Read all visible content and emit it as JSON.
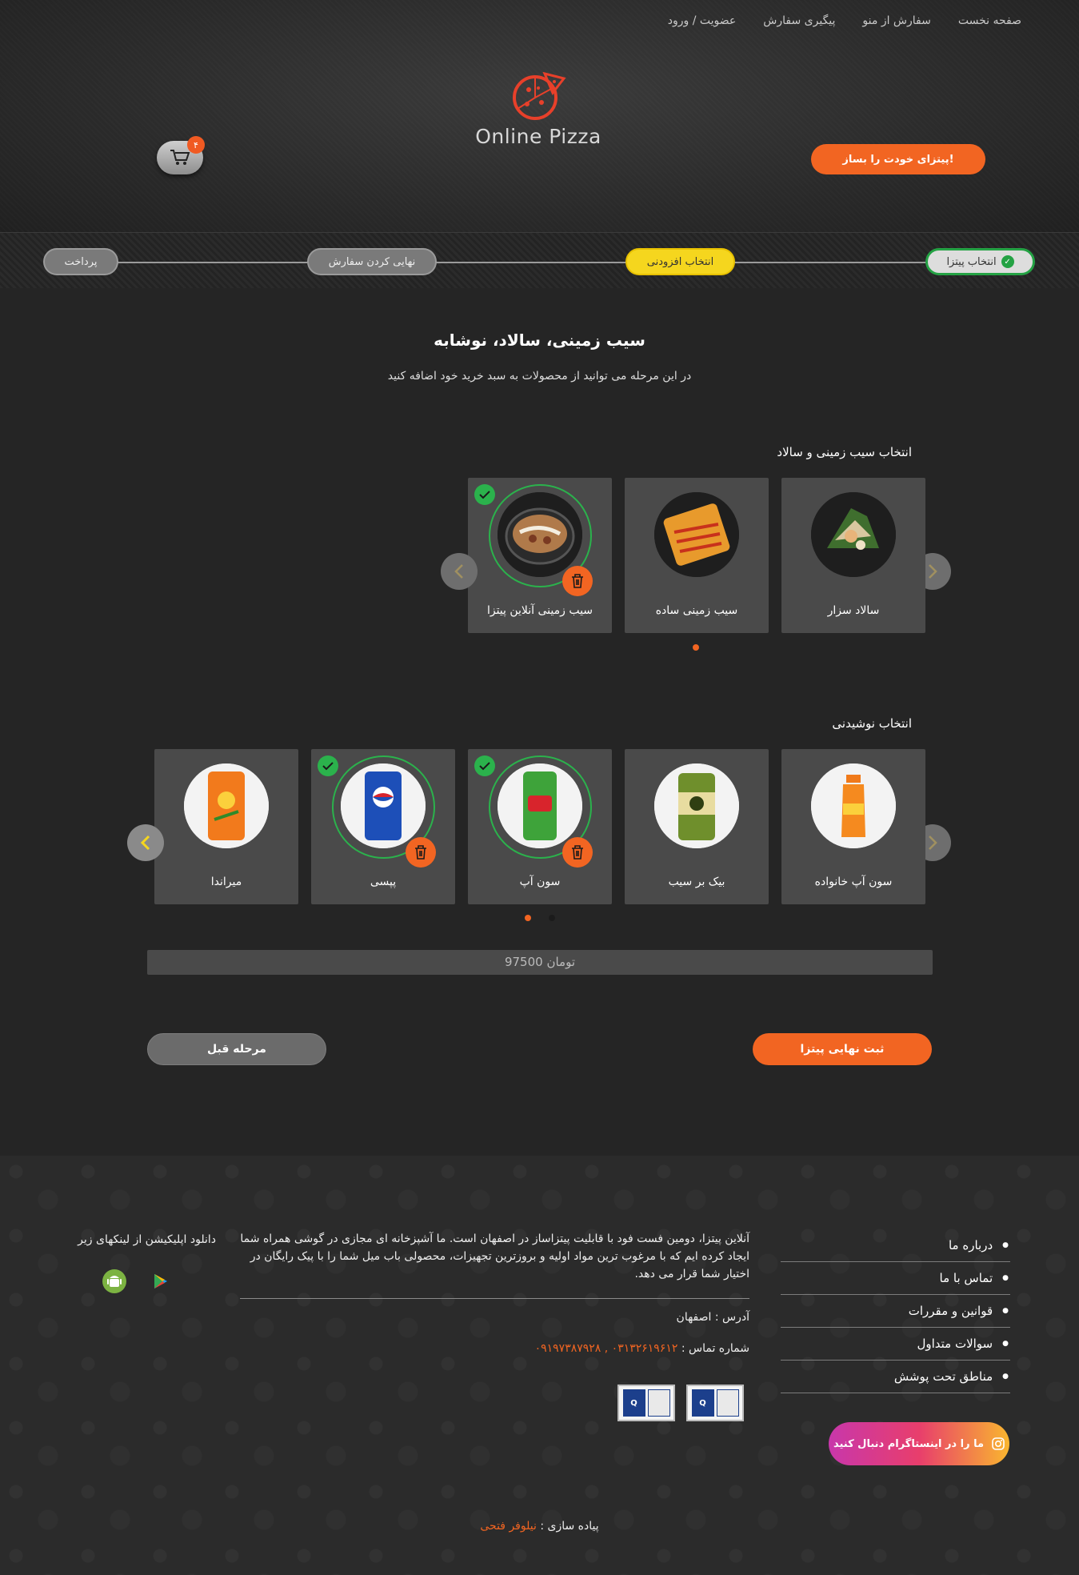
{
  "nav": {
    "items": [
      "صفحه نخست",
      "سفارش از منو",
      "پیگیری سفارش",
      "عضویت / ورود"
    ]
  },
  "logo": {
    "text": "Online Pizza"
  },
  "cart": {
    "count": "۴"
  },
  "build_button": "پیتزای خودت را بساز!",
  "steps": {
    "step1": "انتخاب پیتزا",
    "step2": "انتخاب افزودنی",
    "step3": "نهایی کردن سفارش",
    "step4": "پرداخت"
  },
  "main": {
    "title": "سیب زمینی، سالاد، نوشابه",
    "subtitle": "در این مرحله می توانید از محصولات به سبد خرید خود اضافه کنید"
  },
  "sides": {
    "title": "انتخاب سیب زمینی و سالاد",
    "items": [
      {
        "name": "سالاد سزار",
        "selected": false
      },
      {
        "name": "سیب زمینی ساده",
        "selected": false
      },
      {
        "name": "سیب زمینی آنلاین پیتزا",
        "selected": true
      }
    ]
  },
  "drinks": {
    "title": "انتخاب نوشیدنی",
    "items": [
      {
        "name": "سون آپ خانواده",
        "selected": false
      },
      {
        "name": "بیک بر سیب",
        "selected": false
      },
      {
        "name": "سون آپ",
        "selected": true
      },
      {
        "name": "پپسی",
        "selected": true
      },
      {
        "name": "میراندا",
        "selected": false
      }
    ]
  },
  "total": "97500 تومان",
  "buttons": {
    "submit": "ثبت نهایی پیتزا",
    "previous": "مرحله قبل"
  },
  "footer": {
    "links": [
      "درباره ما",
      "تماس با ما",
      "قوانین و مقررات",
      "سوالات متداول",
      "مناطق تحت پوشش"
    ],
    "about": "آنلاین پیتزا، دومین فست فود با قابلیت پیتزاساز در اصفهان است. ما آشپزخانه ای مجازی در گوشی همراه شما ایجاد کرده ایم که با مرغوب ترین مواد اولیه و بروزترین تجهیزات، محصولی باب میل شما را با پیک رایگان در اختیار شما قرار می دهد.",
    "address": "آدرس : اصفهان",
    "phone_label": "شماره تماس :",
    "phone_numbers": "۰۳۱۳۲۶۱۹۶۱۲ , ۰۹۱۹۷۳۸۷۹۲۸",
    "instagram": "ما را در اینستاگرام دنبال کنید",
    "download": "دانلود اپلیکیشن از لینکهای زیر",
    "credit_label": "پیاده سازی :",
    "credit_name": "نیلوفر فتحی"
  },
  "colors": {
    "accent": "#f26522",
    "active_step": "#f5d61e",
    "done": "#2bb24c"
  }
}
